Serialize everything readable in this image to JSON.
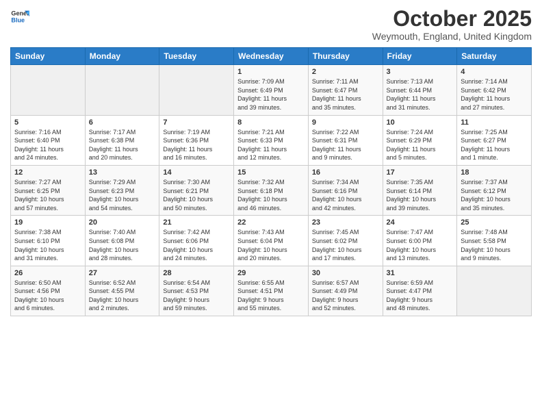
{
  "logo": {
    "line1": "General",
    "line2": "Blue"
  },
  "header": {
    "month": "October 2025",
    "location": "Weymouth, England, United Kingdom"
  },
  "weekdays": [
    "Sunday",
    "Monday",
    "Tuesday",
    "Wednesday",
    "Thursday",
    "Friday",
    "Saturday"
  ],
  "weeks": [
    [
      {
        "day": "",
        "info": ""
      },
      {
        "day": "",
        "info": ""
      },
      {
        "day": "",
        "info": ""
      },
      {
        "day": "1",
        "info": "Sunrise: 7:09 AM\nSunset: 6:49 PM\nDaylight: 11 hours\nand 39 minutes."
      },
      {
        "day": "2",
        "info": "Sunrise: 7:11 AM\nSunset: 6:47 PM\nDaylight: 11 hours\nand 35 minutes."
      },
      {
        "day": "3",
        "info": "Sunrise: 7:13 AM\nSunset: 6:44 PM\nDaylight: 11 hours\nand 31 minutes."
      },
      {
        "day": "4",
        "info": "Sunrise: 7:14 AM\nSunset: 6:42 PM\nDaylight: 11 hours\nand 27 minutes."
      }
    ],
    [
      {
        "day": "5",
        "info": "Sunrise: 7:16 AM\nSunset: 6:40 PM\nDaylight: 11 hours\nand 24 minutes."
      },
      {
        "day": "6",
        "info": "Sunrise: 7:17 AM\nSunset: 6:38 PM\nDaylight: 11 hours\nand 20 minutes."
      },
      {
        "day": "7",
        "info": "Sunrise: 7:19 AM\nSunset: 6:36 PM\nDaylight: 11 hours\nand 16 minutes."
      },
      {
        "day": "8",
        "info": "Sunrise: 7:21 AM\nSunset: 6:33 PM\nDaylight: 11 hours\nand 12 minutes."
      },
      {
        "day": "9",
        "info": "Sunrise: 7:22 AM\nSunset: 6:31 PM\nDaylight: 11 hours\nand 9 minutes."
      },
      {
        "day": "10",
        "info": "Sunrise: 7:24 AM\nSunset: 6:29 PM\nDaylight: 11 hours\nand 5 minutes."
      },
      {
        "day": "11",
        "info": "Sunrise: 7:25 AM\nSunset: 6:27 PM\nDaylight: 11 hours\nand 1 minute."
      }
    ],
    [
      {
        "day": "12",
        "info": "Sunrise: 7:27 AM\nSunset: 6:25 PM\nDaylight: 10 hours\nand 57 minutes."
      },
      {
        "day": "13",
        "info": "Sunrise: 7:29 AM\nSunset: 6:23 PM\nDaylight: 10 hours\nand 54 minutes."
      },
      {
        "day": "14",
        "info": "Sunrise: 7:30 AM\nSunset: 6:21 PM\nDaylight: 10 hours\nand 50 minutes."
      },
      {
        "day": "15",
        "info": "Sunrise: 7:32 AM\nSunset: 6:18 PM\nDaylight: 10 hours\nand 46 minutes."
      },
      {
        "day": "16",
        "info": "Sunrise: 7:34 AM\nSunset: 6:16 PM\nDaylight: 10 hours\nand 42 minutes."
      },
      {
        "day": "17",
        "info": "Sunrise: 7:35 AM\nSunset: 6:14 PM\nDaylight: 10 hours\nand 39 minutes."
      },
      {
        "day": "18",
        "info": "Sunrise: 7:37 AM\nSunset: 6:12 PM\nDaylight: 10 hours\nand 35 minutes."
      }
    ],
    [
      {
        "day": "19",
        "info": "Sunrise: 7:38 AM\nSunset: 6:10 PM\nDaylight: 10 hours\nand 31 minutes."
      },
      {
        "day": "20",
        "info": "Sunrise: 7:40 AM\nSunset: 6:08 PM\nDaylight: 10 hours\nand 28 minutes."
      },
      {
        "day": "21",
        "info": "Sunrise: 7:42 AM\nSunset: 6:06 PM\nDaylight: 10 hours\nand 24 minutes."
      },
      {
        "day": "22",
        "info": "Sunrise: 7:43 AM\nSunset: 6:04 PM\nDaylight: 10 hours\nand 20 minutes."
      },
      {
        "day": "23",
        "info": "Sunrise: 7:45 AM\nSunset: 6:02 PM\nDaylight: 10 hours\nand 17 minutes."
      },
      {
        "day": "24",
        "info": "Sunrise: 7:47 AM\nSunset: 6:00 PM\nDaylight: 10 hours\nand 13 minutes."
      },
      {
        "day": "25",
        "info": "Sunrise: 7:48 AM\nSunset: 5:58 PM\nDaylight: 10 hours\nand 9 minutes."
      }
    ],
    [
      {
        "day": "26",
        "info": "Sunrise: 6:50 AM\nSunset: 4:56 PM\nDaylight: 10 hours\nand 6 minutes."
      },
      {
        "day": "27",
        "info": "Sunrise: 6:52 AM\nSunset: 4:55 PM\nDaylight: 10 hours\nand 2 minutes."
      },
      {
        "day": "28",
        "info": "Sunrise: 6:54 AM\nSunset: 4:53 PM\nDaylight: 9 hours\nand 59 minutes."
      },
      {
        "day": "29",
        "info": "Sunrise: 6:55 AM\nSunset: 4:51 PM\nDaylight: 9 hours\nand 55 minutes."
      },
      {
        "day": "30",
        "info": "Sunrise: 6:57 AM\nSunset: 4:49 PM\nDaylight: 9 hours\nand 52 minutes."
      },
      {
        "day": "31",
        "info": "Sunrise: 6:59 AM\nSunset: 4:47 PM\nDaylight: 9 hours\nand 48 minutes."
      },
      {
        "day": "",
        "info": ""
      }
    ]
  ]
}
